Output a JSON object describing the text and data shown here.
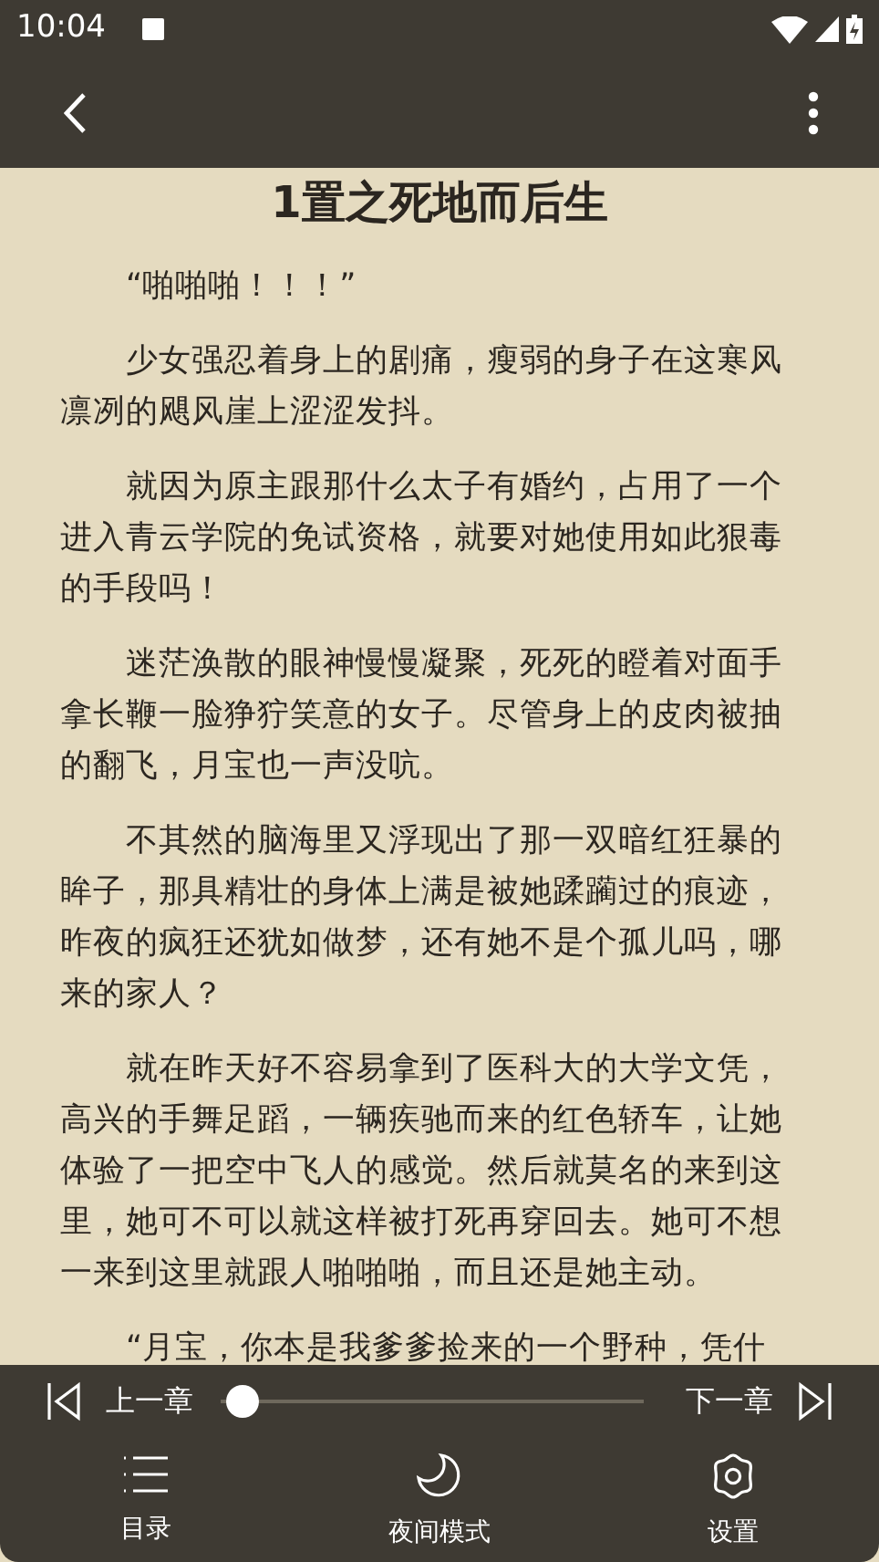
{
  "status_bar": {
    "time": "10:04"
  },
  "chapter": {
    "title": "1置之死地而后生",
    "paragraphs": [
      "“啪啪啪！！！”",
      "少女强忍着身上的剧痛，瘦弱的身子在这寒风凛冽的飓风崖上涩涩发抖。",
      "就因为原主跟那什么太子有婚约，占用了一个进入青云学院的免试资格，就要对她使用如此狠毒的手段吗！",
      "迷茫涣散的眼神慢慢凝聚，死死的瞪着对面手拿长鞭一脸狰狞笑意的女子。尽管身上的皮肉被抽的翻飞，月宝也一声没吭。",
      "不其然的脑海里又浮现出了那一双暗红狂暴的眸子，那具精壮的身体上满是被她蹂躏过的痕迹，昨夜的疯狂还犹如做梦，还有她不是个孤儿吗，哪来的家人？",
      "就在昨天好不容易拿到了医科大的大学文凭，高兴的手舞足蹈，一辆疾驰而来的红色轿车，让她体验了一把空中飞人的感觉。然后就莫名的来到这里，她可不可以就这样被打死再穿回去。她可不想一来到这里就跟人啪啪啪，而且还是她主动。",
      "“月宝，你本是我爹爹捡来的一个野种，凭什"
    ]
  },
  "bottom_panel": {
    "prev_label": "上一章",
    "next_label": "下一章",
    "slider": {
      "level": 0.05
    },
    "actions": [
      {
        "kind": "toc",
        "label": "目录"
      },
      {
        "kind": "night",
        "label": "夜间模式"
      },
      {
        "kind": "settings",
        "label": "设置"
      }
    ]
  }
}
